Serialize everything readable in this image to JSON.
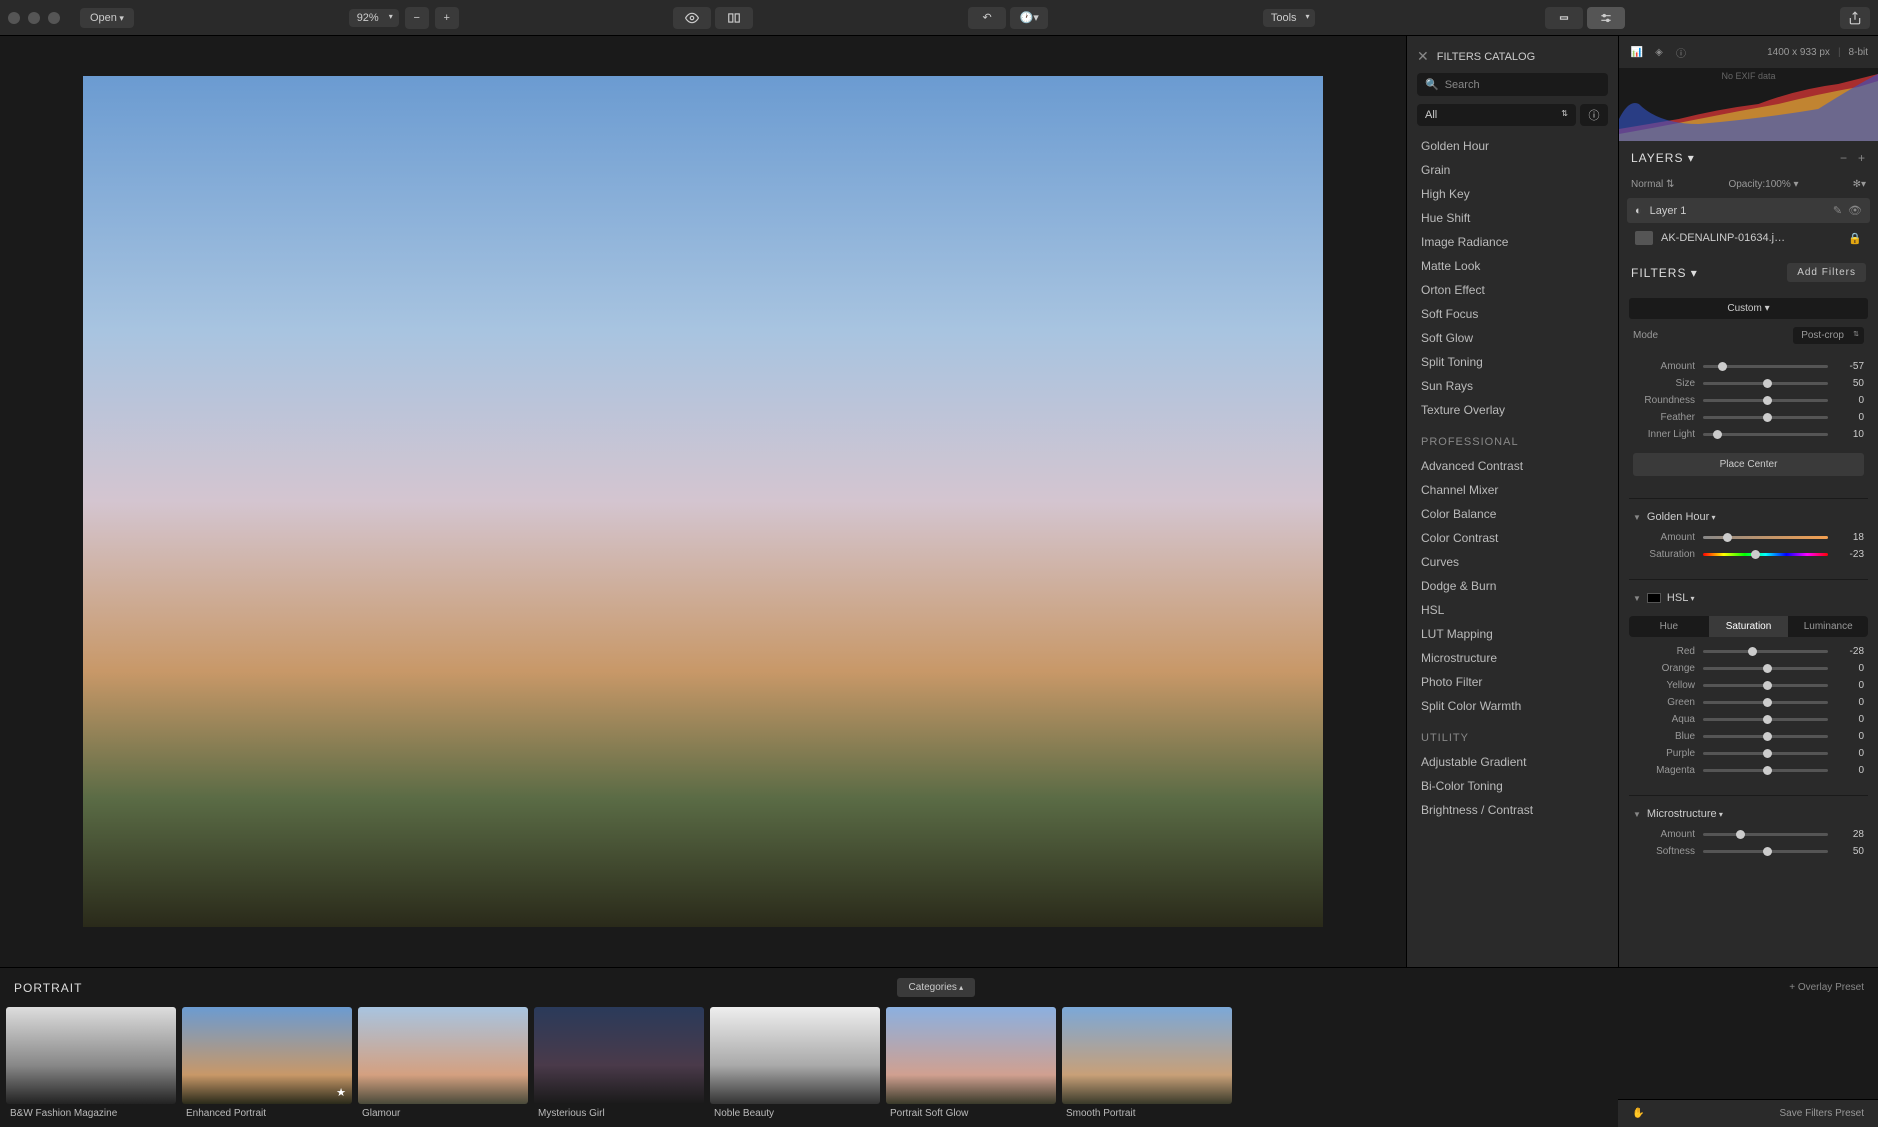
{
  "toolbar": {
    "open": "Open",
    "zoom": "92%",
    "tools": "Tools"
  },
  "info": {
    "dimensions": "1400 x 933 px",
    "depth": "8-bit",
    "exif": "No EXIF data"
  },
  "catalog": {
    "title": "FILTERS CATALOG",
    "search": "Search",
    "select": "All",
    "creative": [
      "Golden Hour",
      "Grain",
      "High Key",
      "Hue Shift",
      "Image Radiance",
      "Matte Look",
      "Orton Effect",
      "Soft Focus",
      "Soft Glow",
      "Split Toning",
      "Sun Rays",
      "Texture Overlay"
    ],
    "professional_label": "PROFESSIONAL",
    "professional": [
      "Advanced Contrast",
      "Channel Mixer",
      "Color Balance",
      "Color Contrast",
      "Curves",
      "Dodge & Burn",
      "HSL",
      "LUT Mapping",
      "Microstructure",
      "Photo Filter",
      "Split Color Warmth"
    ],
    "utility_label": "UTILITY",
    "utility": [
      "Adjustable Gradient",
      "Bi-Color Toning",
      "Brightness / Contrast"
    ]
  },
  "layers": {
    "title": "LAYERS",
    "blend": "Normal",
    "opacity_label": "Opacity:",
    "opacity_value": "100%",
    "layer1": "Layer 1",
    "base": "AK-DENALINP-01634.j…"
  },
  "filters": {
    "title": "FILTERS",
    "add": "Add Filters",
    "custom": "Custom",
    "mode_label": "Mode",
    "mode_value": "Post-crop",
    "vignette": {
      "amount_label": "Amount",
      "amount_val": "-57",
      "size_label": "Size",
      "size_val": "50",
      "roundness_label": "Roundness",
      "roundness_val": "0",
      "feather_label": "Feather",
      "feather_val": "0",
      "inner_label": "Inner Light",
      "inner_val": "10"
    },
    "place_center": "Place Center",
    "golden_hour": {
      "title": "Golden Hour",
      "amount_label": "Amount",
      "amount_val": "18",
      "saturation_label": "Saturation",
      "saturation_val": "-23"
    },
    "hsl": {
      "title": "HSL",
      "tab_hue": "Hue",
      "tab_sat": "Saturation",
      "tab_lum": "Luminance",
      "red": "Red",
      "red_val": "-28",
      "orange": "Orange",
      "orange_val": "0",
      "yellow": "Yellow",
      "yellow_val": "0",
      "green": "Green",
      "green_val": "0",
      "aqua": "Aqua",
      "aqua_val": "0",
      "blue": "Blue",
      "blue_val": "0",
      "purple": "Purple",
      "purple_val": "0",
      "magenta": "Magenta",
      "magenta_val": "0"
    },
    "micro": {
      "title": "Microstructure",
      "amount_label": "Amount",
      "amount_val": "28",
      "softness_label": "Softness",
      "softness_val": "50"
    }
  },
  "filmstrip": {
    "title": "PORTRAIT",
    "categories": "Categories",
    "overlay": "+ Overlay Preset",
    "presets": [
      "B&W Fashion Magazine",
      "Enhanced Portrait",
      "Glamour",
      "Mysterious Girl",
      "Noble Beauty",
      "Portrait Soft Glow",
      "Smooth Portrait"
    ]
  },
  "save_bar": "Save Filters Preset"
}
